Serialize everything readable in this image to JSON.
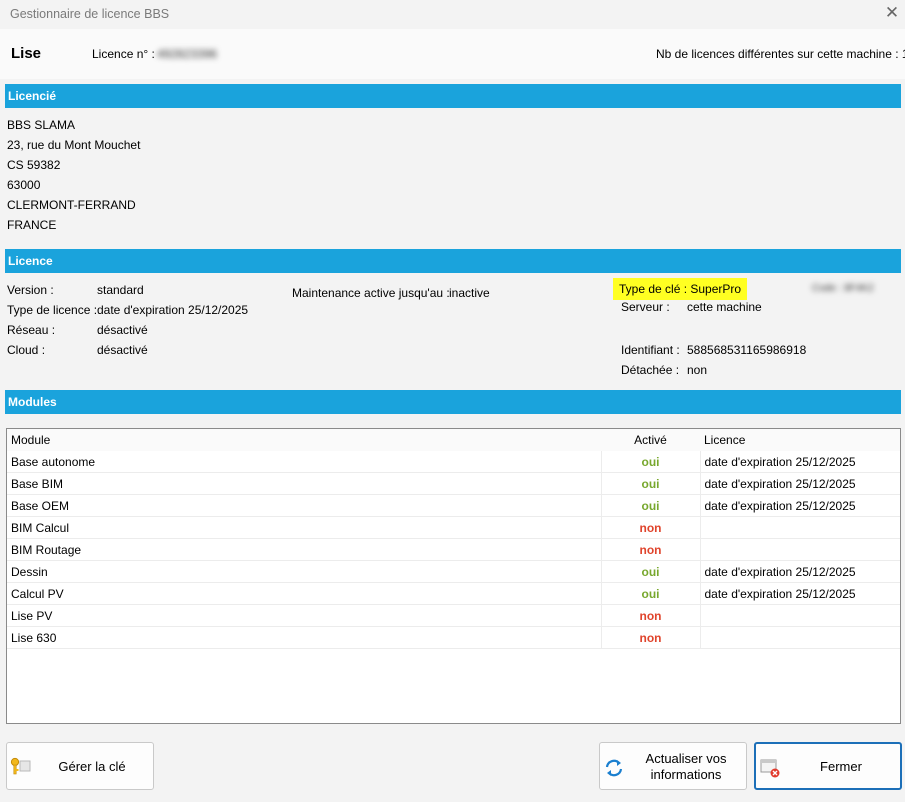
{
  "window": {
    "title": "Gestionnaire de licence BBS",
    "close_glyph": "✕"
  },
  "header": {
    "product": "Lise",
    "licence_label": "Licence n° :",
    "licence_number": "492823396",
    "count_text": "Nb de licences différentes sur cette machine : 1"
  },
  "licencie": {
    "heading": "Licencié",
    "lines": [
      "BBS SLAMA",
      "23, rue du Mont Mouchet",
      "CS 59382",
      "63000",
      "CLERMONT-FERRAND",
      "FRANCE"
    ]
  },
  "licence": {
    "heading": "Licence",
    "version_label": "Version :",
    "version_value": "standard",
    "type_label": "Type de licence :",
    "type_value": "date d'expiration 25/12/2025",
    "reseau_label": "Réseau :",
    "reseau_value": "désactivé",
    "cloud_label": "Cloud :",
    "cloud_value": "désactivé",
    "maintenance_label": "Maintenance active jusqu'au :",
    "maintenance_value": "inactive",
    "cle_text": "Type de clé : SuperPro",
    "code_text": "Code : 8F4K2",
    "serveur_label": "Serveur :",
    "serveur_value": "cette machine",
    "identifiant_label": "Identifiant :",
    "identifiant_value": "588568531165986918",
    "detachee_label": "Détachée :",
    "detachee_value": "non"
  },
  "modules": {
    "heading": "Modules",
    "columns": [
      "Module",
      "Activé",
      "Licence"
    ],
    "rows": [
      {
        "name": "Base autonome",
        "active": "oui",
        "licence": "date d'expiration 25/12/2025"
      },
      {
        "name": "Base BIM",
        "active": "oui",
        "licence": "date d'expiration 25/12/2025"
      },
      {
        "name": "Base OEM",
        "active": "oui",
        "licence": "date d'expiration 25/12/2025"
      },
      {
        "name": "BIM Calcul",
        "active": "non",
        "licence": ""
      },
      {
        "name": "BIM Routage",
        "active": "non",
        "licence": ""
      },
      {
        "name": "Dessin",
        "active": "oui",
        "licence": "date d'expiration 25/12/2025"
      },
      {
        "name": "Calcul PV",
        "active": "oui",
        "licence": "date d'expiration 25/12/2025"
      },
      {
        "name": "Lise PV",
        "active": "non",
        "licence": ""
      },
      {
        "name": "Lise 630",
        "active": "non",
        "licence": ""
      }
    ]
  },
  "buttons": {
    "gerer": "Gérer la clé",
    "actualiser_line1": "Actualiser vos",
    "actualiser_line2": "informations",
    "fermer": "Fermer"
  },
  "colors": {
    "section_bar": "#1aa3dc",
    "oui": "#78a82e",
    "non": "#e0442c",
    "highlight": "#ffff22",
    "primary_border": "#1c6fb8"
  }
}
